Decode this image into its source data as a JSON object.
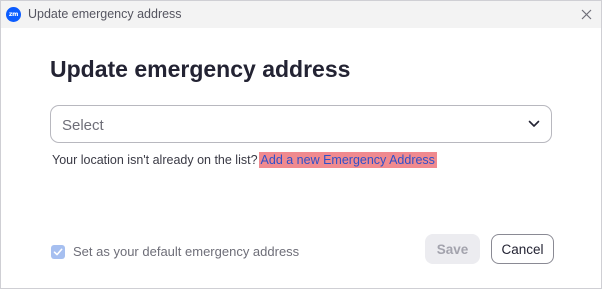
{
  "window": {
    "app_icon_text": "zm",
    "title": "Update emergency address"
  },
  "dialog": {
    "heading": "Update emergency address",
    "select": {
      "placeholder": "Select"
    },
    "hint_text": "Your location isn't already on the list?",
    "add_link_label": "Add a new Emergency Address",
    "default_checkbox": {
      "label": "Set as your default emergency address",
      "checked": true
    },
    "buttons": {
      "save_label": "Save",
      "cancel_label": "Cancel"
    }
  },
  "colors": {
    "brand": "#0b5cff",
    "link_highlight": "#f08a8f",
    "link_text": "#2f50c9",
    "checkbox_fill": "#a6bff0"
  },
  "icons": {
    "app": "zoom-logo-icon",
    "close": "close-icon",
    "dropdown": "chevron-down-icon",
    "checkmark": "checkmark-icon"
  }
}
